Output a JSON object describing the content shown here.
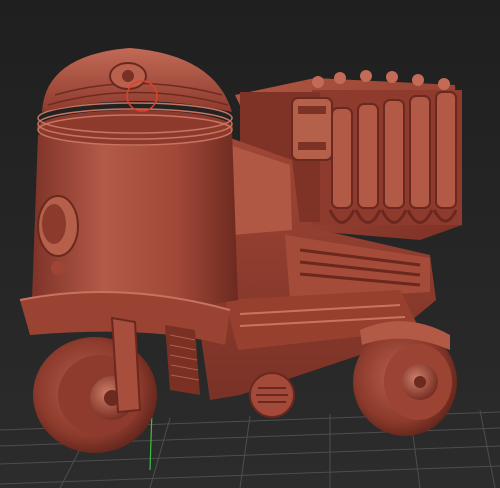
{
  "viewport": {
    "background": "#232323",
    "grid_color": "#5a5a5a",
    "axis_green": "#3fbf3f"
  },
  "model": {
    "subject": "sculpted-vehicle-render",
    "material_color": "#a44a3b",
    "highlight_color": "#d98a78",
    "shadow_color": "#5a2219",
    "cursor_brush_color": "#e0402a"
  }
}
